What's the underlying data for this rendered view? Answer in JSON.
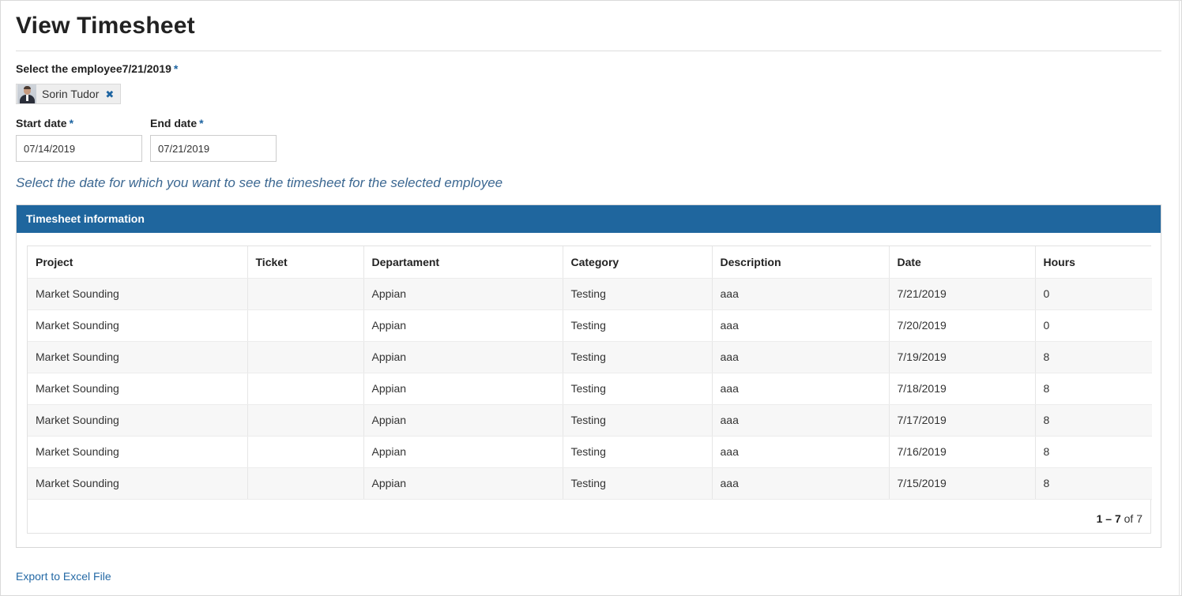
{
  "page": {
    "title": "View Timesheet"
  },
  "employee_field": {
    "label": "Select the employee7/21/2019",
    "required_marker": "*",
    "selected_user": {
      "name": "Sorin Tudor",
      "remove_icon": "✖"
    }
  },
  "start_date": {
    "label": "Start date",
    "required_marker": "*",
    "value": "07/14/2019"
  },
  "end_date": {
    "label": "End date",
    "required_marker": "*",
    "value": "07/21/2019"
  },
  "instructions": "Select the date for which you want to see the timesheet for the selected employee",
  "section": {
    "title": "Timesheet information"
  },
  "grid": {
    "columns": [
      "Project",
      "Ticket",
      "Departament",
      "Category",
      "Description",
      "Date",
      "Hours"
    ],
    "rows": [
      [
        "Market Sounding",
        "",
        "Appian",
        "Testing",
        "aaa",
        "7/21/2019",
        "0"
      ],
      [
        "Market Sounding",
        "",
        "Appian",
        "Testing",
        "aaa",
        "7/20/2019",
        "0"
      ],
      [
        "Market Sounding",
        "",
        "Appian",
        "Testing",
        "aaa",
        "7/19/2019",
        "8"
      ],
      [
        "Market Sounding",
        "",
        "Appian",
        "Testing",
        "aaa",
        "7/18/2019",
        "8"
      ],
      [
        "Market Sounding",
        "",
        "Appian",
        "Testing",
        "aaa",
        "7/17/2019",
        "8"
      ],
      [
        "Market Sounding",
        "",
        "Appian",
        "Testing",
        "aaa",
        "7/16/2019",
        "8"
      ],
      [
        "Market Sounding",
        "",
        "Appian",
        "Testing",
        "aaa",
        "7/15/2019",
        "8"
      ]
    ],
    "pager": {
      "range": "1 – 7",
      "of_label": "of",
      "total": "7"
    }
  },
  "export_link": "Export to Excel File",
  "colors": {
    "header_bar": "#1f669e",
    "link": "#2469a5",
    "required": "#1d64a1",
    "instructions": "#3b6791"
  }
}
